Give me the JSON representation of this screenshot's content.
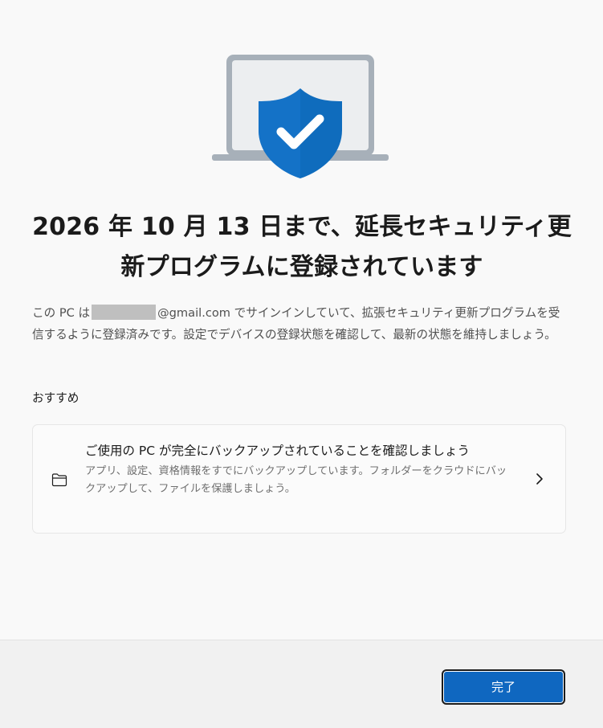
{
  "hero": {
    "icon": "laptop-shield-check-icon",
    "colors": {
      "shield": "#0f6cbd",
      "laptop_frame": "#a7b0b9",
      "laptop_screen": "#eceef0",
      "check": "#ffffff"
    }
  },
  "title": "2026 年 10 月 13 日まで、延長セキュリティ更新プログラムに登録されています",
  "description": {
    "before_email": "この PC は",
    "email_suffix": "@gmail.com",
    "after_email": " でサインインしていて、拡張セキュリティ更新プログラムを受信するように登録済みです。設定でデバイスの登録状態を確認して、最新の状態を維持しましょう。"
  },
  "recommended": {
    "label": "おすすめ",
    "card": {
      "icon": "folder-icon",
      "title": "ご使用の PC が完全にバックアップされていることを確認しましょう",
      "subtitle": "アプリ、設定、資格情報をすでにバックアップしています。フォルダーをクラウドにバックアップして、ファイルを保護しましょう。",
      "chevron_icon": "chevron-right-icon"
    }
  },
  "footer": {
    "done_label": "完了",
    "accent": "#0f67c0"
  }
}
